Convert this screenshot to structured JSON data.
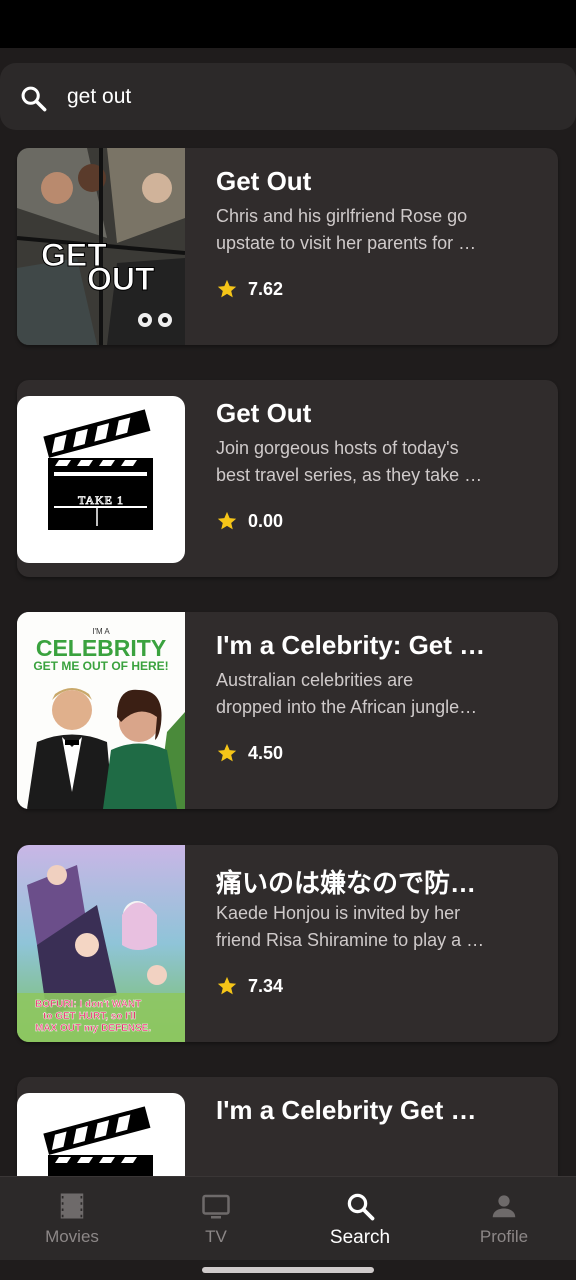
{
  "search": {
    "value": "get out"
  },
  "results": [
    {
      "title": "Get Out",
      "desc_line1": "Chris and his girlfriend Rose go",
      "desc_line2": "upstate to visit her parents for …",
      "rating": "7.62",
      "poster_text_1": "GET",
      "poster_text_2": "OUT"
    },
    {
      "title": "Get Out",
      "desc_line1": "Join gorgeous hosts of today's",
      "desc_line2": "best travel series, as they take …",
      "rating": "0.00",
      "clapper_text": "TAKE 1"
    },
    {
      "title": "I'm a Celebrity: Get …",
      "desc_line1": "Australian celebrities are",
      "desc_line2": "dropped into the African jungle…",
      "rating": "4.50",
      "poster_text_small": "I'M A",
      "poster_text_1": "CELEBRITY",
      "poster_text_2": "GET ME OUT OF HERE!"
    },
    {
      "title": "痛いのは嫌なので防…",
      "desc_line1": "Kaede Honjou is invited by her",
      "desc_line2": "friend Risa Shiramine to play a …",
      "rating": "7.34",
      "poster_text_1": "BOFURI: I don't WANT",
      "poster_text_2": "to GET HURT, so I'll",
      "poster_text_3": "MAX OUT my DEFENSE."
    },
    {
      "title": "I'm a Celebrity Get …"
    }
  ],
  "nav": {
    "items": [
      {
        "label": "Movies",
        "icon": "film-icon"
      },
      {
        "label": "TV",
        "icon": "tv-icon"
      },
      {
        "label": "Search",
        "icon": "search-icon"
      },
      {
        "label": "Profile",
        "icon": "person-icon"
      }
    ],
    "active": "Search"
  },
  "colors": {
    "background": "#1f1c1c",
    "card": "#302c2c",
    "star": "#f5c518",
    "inactive": "#8c8787"
  }
}
